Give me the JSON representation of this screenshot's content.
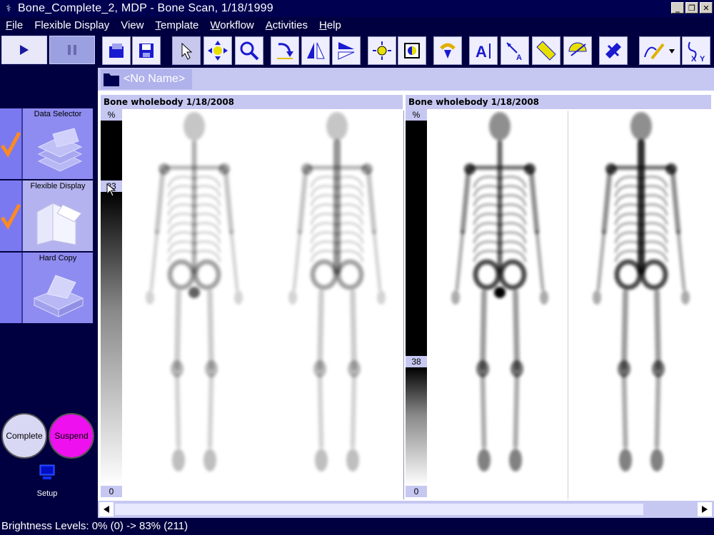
{
  "window": {
    "title": "Bone_Complete_2, MDP - Bone Scan, 1/18/1999",
    "min_label": "_",
    "restore_label": "❐",
    "close_label": "✕"
  },
  "menu": [
    {
      "label": "File"
    },
    {
      "label": "Flexible Display"
    },
    {
      "label": "View"
    },
    {
      "label": "Template"
    },
    {
      "label": "Workflow"
    },
    {
      "label": "Activities"
    },
    {
      "label": "Help"
    }
  ],
  "workflow": {
    "tasks": [
      {
        "label": "Data Selector",
        "completed": true
      },
      {
        "label": "Flexible Display",
        "completed": true
      },
      {
        "label": "Hard Copy",
        "completed": false
      }
    ],
    "complete_label": "Complete",
    "suspend_label": "Suspend",
    "setup_label": "Setup"
  },
  "toolbar_icons": [
    "save-icon",
    "save-as-icon",
    "pointer-icon",
    "pan-icon",
    "zoom-icon",
    "rotate-icon",
    "flip-icon",
    "mirror-icon",
    "brightness-icon",
    "contrast-icon",
    "reset-icon",
    "text-annotation-icon",
    "arrow-label-icon",
    "ruler-icon",
    "protractor-icon",
    "satellite-icon",
    "draw-icon",
    "profile-xy-icon"
  ],
  "tab": {
    "label": "<No Name>"
  },
  "panels": [
    {
      "header": "Bone wholebody 1/18/2008",
      "scale_top": "%",
      "scale_marker": "83",
      "scale_bottom": "0",
      "marker_fraction": 0.83
    },
    {
      "header": "Bone wholebody 1/18/2008",
      "scale_top": "%",
      "scale_marker": "38",
      "scale_bottom": "0",
      "marker_fraction": 0.38
    }
  ],
  "status": {
    "text": "Brightness Levels: 0% (0) -> 83% (211)"
  },
  "colors": {
    "background": "#000040",
    "panel": "#c6c8f2",
    "task_active": "#8e8cf0",
    "check": "#ff8a1f",
    "complete_button": "#d8d8f4",
    "suspend_button": "#ee10ee"
  }
}
